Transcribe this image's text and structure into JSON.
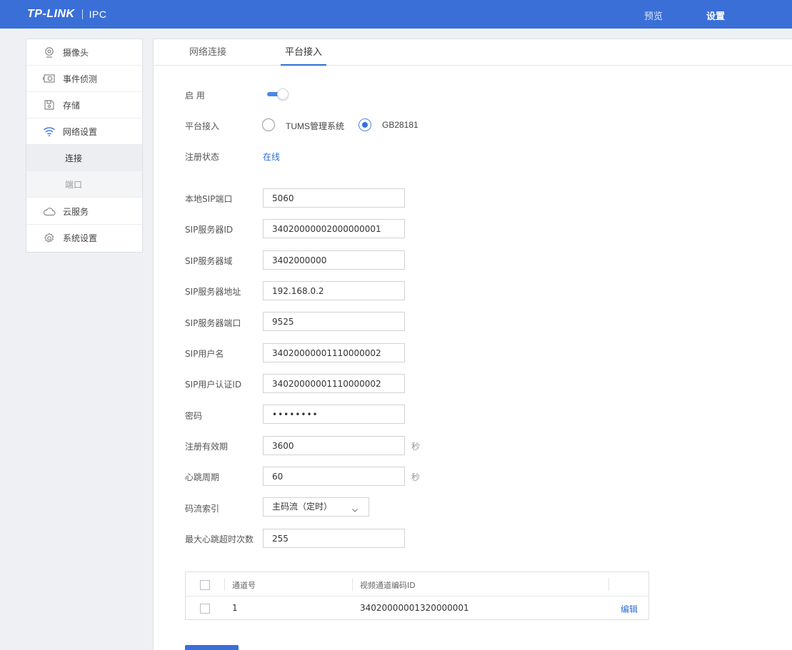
{
  "header": {
    "brand": "TP-LINK",
    "product": "IPC",
    "nav": {
      "preview": "预览",
      "settings": "设置"
    }
  },
  "sidebar": {
    "items": [
      {
        "label": "摄像头",
        "icon": "camera-icon"
      },
      {
        "label": "事件侦测",
        "icon": "event-camera-icon"
      },
      {
        "label": "存储",
        "icon": "storage-icon"
      },
      {
        "label": "网络设置",
        "icon": "wifi-icon"
      },
      {
        "label": "云服务",
        "icon": "cloud-icon"
      },
      {
        "label": "系统设置",
        "icon": "gear-icon"
      }
    ],
    "subitems": [
      {
        "label": "连接",
        "active": true
      },
      {
        "label": "端口",
        "active": false
      }
    ]
  },
  "tabs": [
    {
      "label": "网络连接",
      "active": false
    },
    {
      "label": "平台接入",
      "active": true
    }
  ],
  "form": {
    "enable_label": "启 用",
    "enable_on": true,
    "platform_label": "平台接入",
    "platform_options": [
      "TUMS管理系统",
      "GB28181"
    ],
    "platform_selected": "GB28181",
    "reg_status_label": "注册状态",
    "reg_status_value": "在线",
    "fields": {
      "local_sip_port": {
        "label": "本地SIP端口",
        "value": "5060"
      },
      "sip_server_id": {
        "label": "SIP服务器ID",
        "value": "34020000002000000001"
      },
      "sip_server_domain": {
        "label": "SIP服务器域",
        "value": "3402000000"
      },
      "sip_server_addr": {
        "label": "SIP服务器地址",
        "value": "192.168.0.2"
      },
      "sip_server_port": {
        "label": "SIP服务器端口",
        "value": "9525"
      },
      "sip_username": {
        "label": "SIP用户名",
        "value": "34020000001110000002"
      },
      "sip_auth_id": {
        "label": "SIP用户认证ID",
        "value": "34020000001110000002"
      },
      "password": {
        "label": "密码",
        "value": "••••••••"
      },
      "reg_expiry": {
        "label": "注册有效期",
        "value": "3600",
        "unit": "秒"
      },
      "heartbeat": {
        "label": "心跳周期",
        "value": "60",
        "unit": "秒"
      },
      "max_heartbeat_timeouts": {
        "label": "最大心跳超时次数",
        "value": "255"
      }
    },
    "stream_index": {
      "label": "码流索引",
      "selected": "主码流（定时）"
    }
  },
  "table": {
    "headers": [
      "通道号",
      "视频通道编码ID"
    ],
    "rows": [
      {
        "channel": "1",
        "encode_id": "34020000001320000001",
        "action": "编辑"
      }
    ]
  },
  "colors": {
    "header_bg": "#3a6fd8",
    "link": "#2f6ed2",
    "accent": "#4a86e8"
  }
}
